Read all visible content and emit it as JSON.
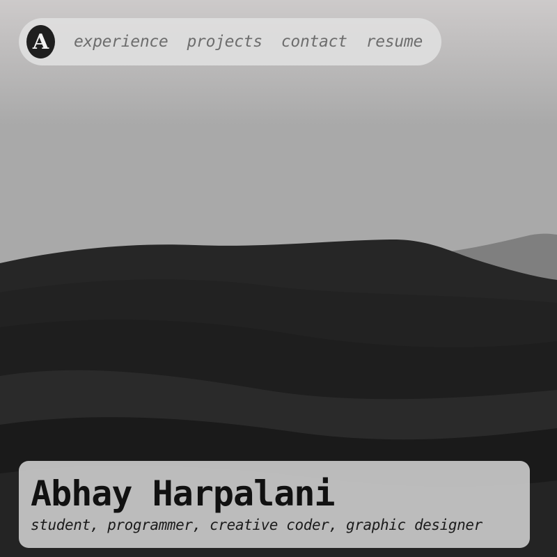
{
  "hero": {
    "image": "dark sand dunes under hazy grey sky"
  },
  "nav": {
    "logo_letter": "A",
    "links": [
      {
        "label": "experience"
      },
      {
        "label": "projects"
      },
      {
        "label": "contact"
      },
      {
        "label": "resume"
      }
    ]
  },
  "profile": {
    "name": "Abhay Harpalani",
    "tagline": "student, programmer, creative coder, graphic designer"
  },
  "colors": {
    "nav_bg": "#dedede",
    "logo_bg": "#1f1f1f",
    "link_text": "#6d6d6d",
    "card_bg": "#c8c8c8",
    "name_text": "#111111"
  }
}
